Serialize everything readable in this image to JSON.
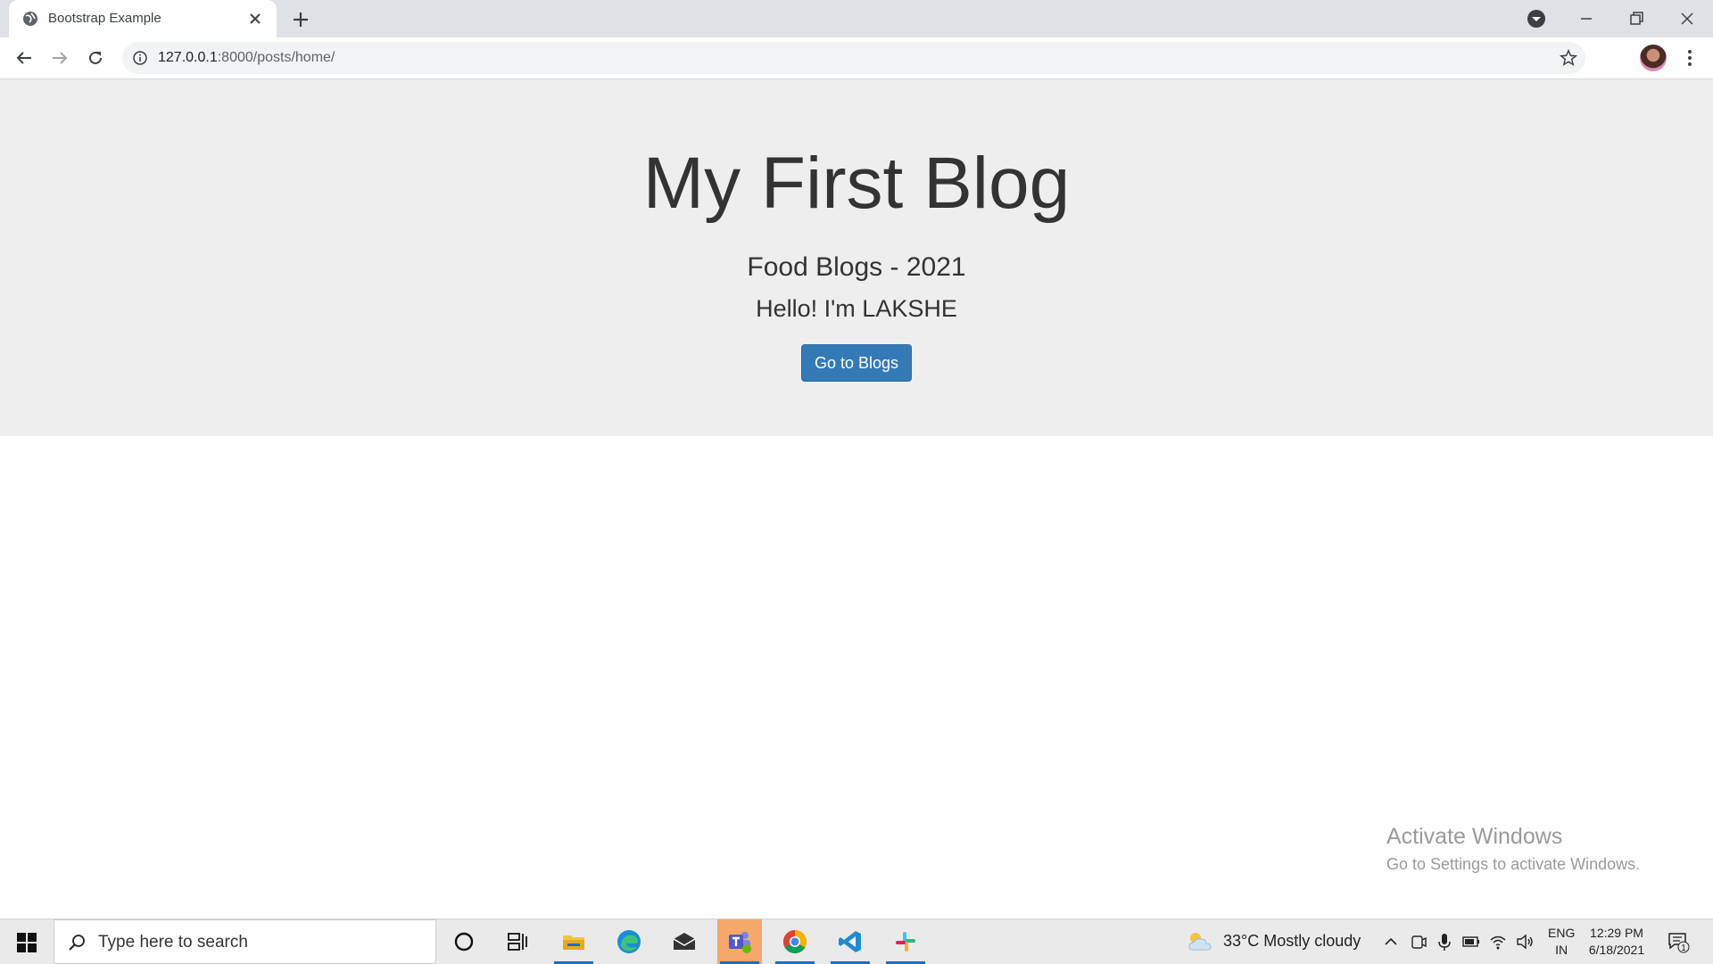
{
  "browser": {
    "tab_title": "Bootstrap Example",
    "url_host": "127.0.0.1",
    "url_rest": ":8000/posts/home/"
  },
  "page": {
    "title": "My First Blog",
    "subtitle": "Food Blogs - 2021",
    "greeting": "Hello! I'm LAKSHE",
    "button_label": "Go to Blogs",
    "background": "#eeeeee",
    "button_color": "#337ab7"
  },
  "watermark": {
    "title": "Activate Windows",
    "subtitle": "Go to Settings to activate Windows."
  },
  "taskbar": {
    "search_placeholder": "Type here to search",
    "weather": "33°C  Mostly cloudy",
    "lang_line1": "ENG",
    "lang_line2": "IN",
    "time": "12:29 PM",
    "date": "6/18/2021",
    "notification_count": "1",
    "apps": [
      "cortana-icon",
      "task-view-icon",
      "file-explorer-icon",
      "edge-icon",
      "mail-icon",
      "teams-icon",
      "chrome-icon",
      "vscode-icon",
      "slack-icon"
    ]
  }
}
